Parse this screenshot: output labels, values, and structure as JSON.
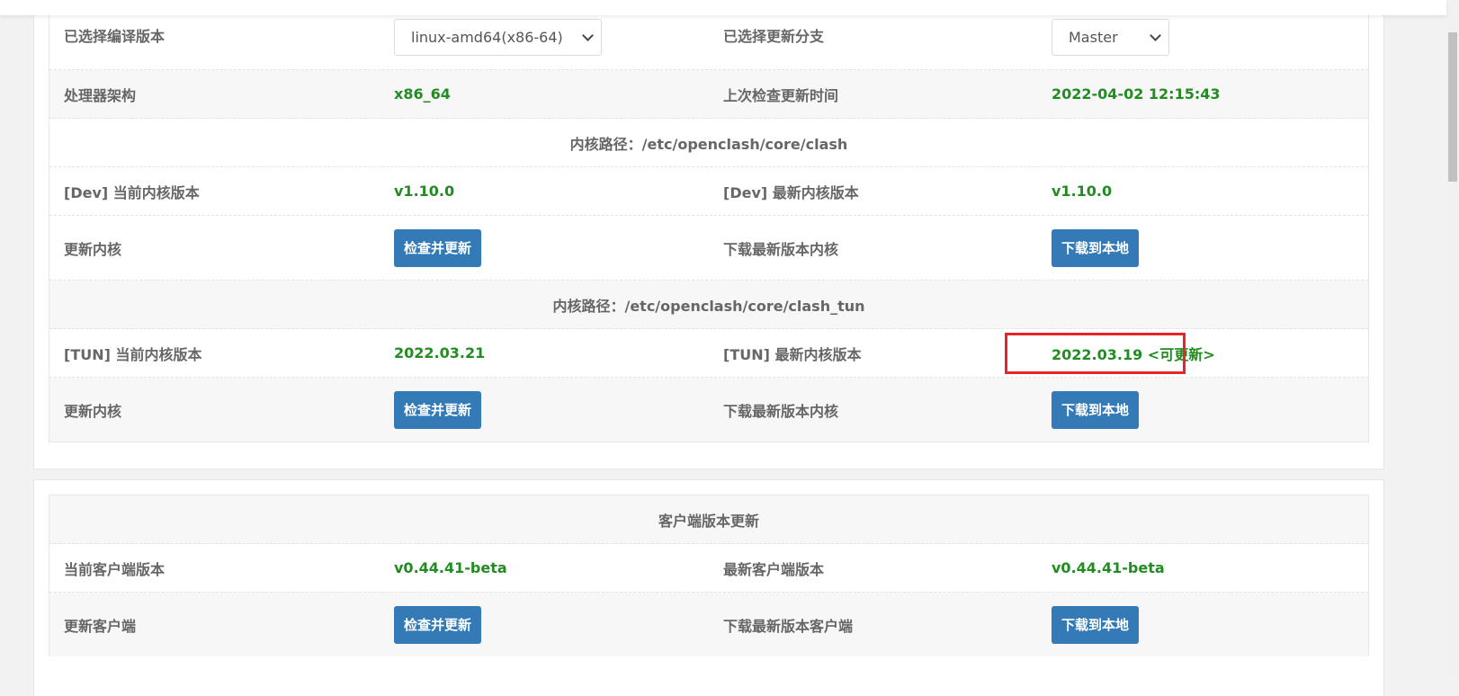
{
  "core": {
    "compile_label": "已选择编译版本",
    "compile_value": "linux-amd64(x86-64)",
    "branch_label": "已选择更新分支",
    "branch_value": "Master",
    "arch_label": "处理器架构",
    "arch_value": "x86_64",
    "last_check_label": "上次检查更新时间",
    "last_check_value": "2022-04-02 12:15:43",
    "dev_path": "内核路径：/etc/openclash/core/clash",
    "dev_current_label": "[Dev] 当前内核版本",
    "dev_current_value": "v1.10.0",
    "dev_latest_label": "[Dev] 最新内核版本",
    "dev_latest_value": "v1.10.0",
    "update_core_label": "更新内核",
    "check_update_btn": "检查并更新",
    "download_latest_core_label": "下载最新版本内核",
    "download_local_btn": "下载到本地",
    "tun_path": "内核路径：/etc/openclash/core/clash_tun",
    "tun_current_label": "[TUN] 当前内核版本",
    "tun_current_value": "2022.03.21",
    "tun_latest_label": "[TUN] 最新内核版本",
    "tun_latest_value": "2022.03.19 <可更新>"
  },
  "client": {
    "title": "客户端版本更新",
    "current_label": "当前客户端版本",
    "current_value": "v0.44.41-beta",
    "latest_label": "最新客户端版本",
    "latest_value": "v0.44.41-beta",
    "update_label": "更新客户端",
    "check_update_btn": "检查并更新",
    "download_label": "下载最新版本客户端",
    "download_local_btn": "下载到本地"
  },
  "colors": {
    "value_green": "#228b22",
    "button_blue": "#337ab7",
    "highlight_red": "#e8242c"
  }
}
